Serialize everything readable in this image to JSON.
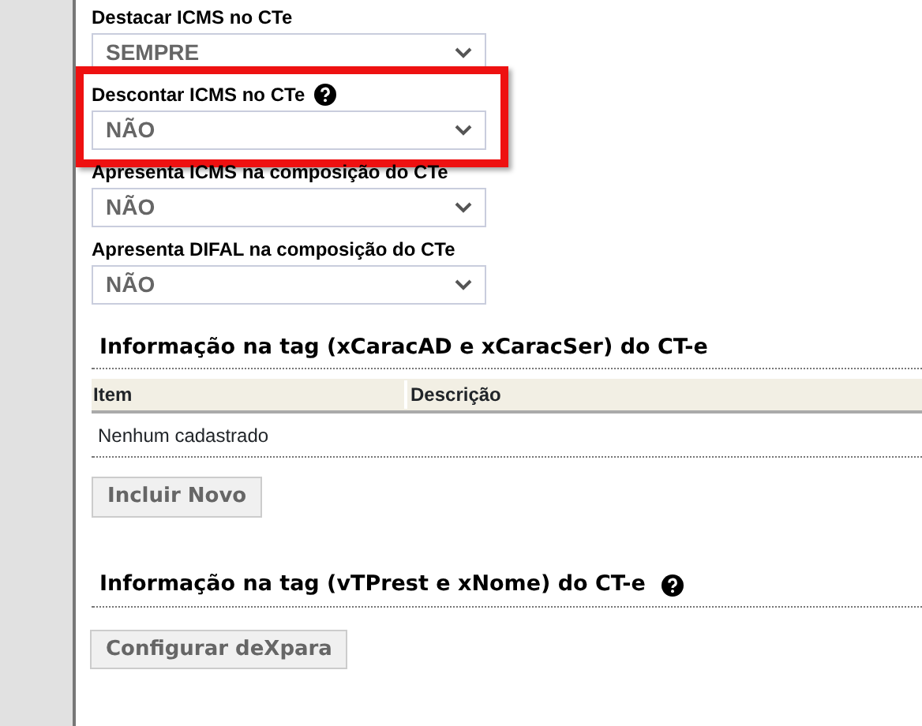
{
  "fields": [
    {
      "label": "Destacar ICMS no CTe",
      "help": false,
      "value": "SEMPRE",
      "highlighted": false
    },
    {
      "label": "Descontar ICMS no CTe",
      "help": true,
      "value": "NÃO",
      "highlighted": true
    },
    {
      "label": "Apresenta ICMS na composição do CTe",
      "help": false,
      "value": "NÃO",
      "highlighted": false
    },
    {
      "label": "Apresenta DIFAL na composição do CTe",
      "help": false,
      "value": "NÃO",
      "highlighted": false
    }
  ],
  "sections": [
    {
      "title": "Informação na tag (xCaracAD e xCaracSer) do CT-e",
      "help": false,
      "table": {
        "columns": [
          "Item",
          "Descrição"
        ],
        "empty_text": "Nenhum cadastrado"
      },
      "button": "Incluir Novo"
    },
    {
      "title": "Informação na tag (vTPrest e xNome) do CT-e",
      "help": true,
      "button": "Configurar deXpara"
    }
  ]
}
